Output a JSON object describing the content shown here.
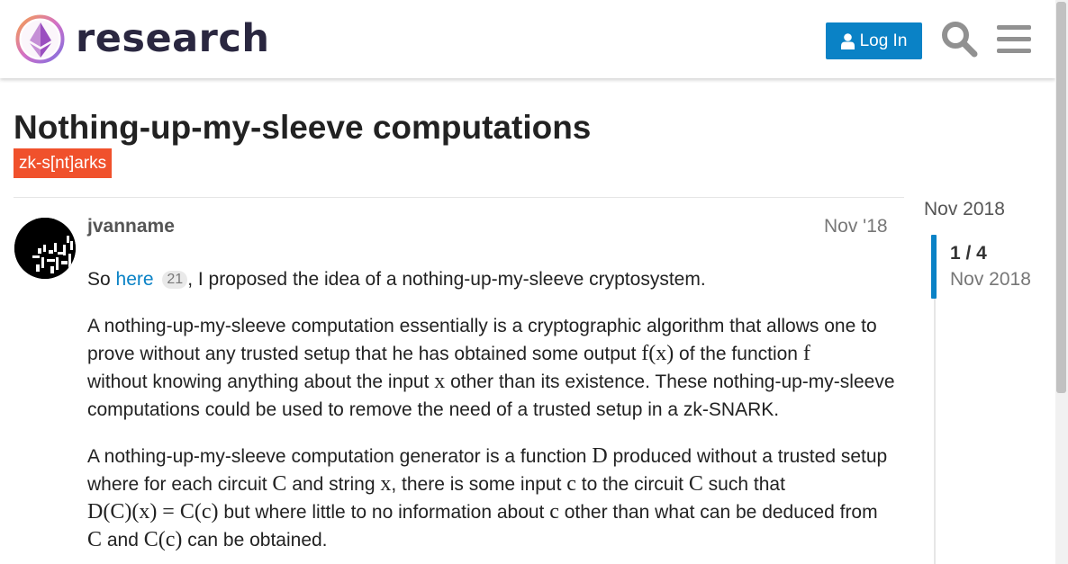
{
  "header": {
    "logo_text": "research",
    "login_label": "Log In"
  },
  "topic": {
    "title": "Nothing-up-my-sleeve computations",
    "tag": "zk-s[nt]arks"
  },
  "post": {
    "username": "jvanname",
    "date": "Nov '18",
    "p1": {
      "before": "So ",
      "link": "here",
      "clicks": "21",
      "after": ", I proposed the idea of a nothing-up-my-sleeve cryptosystem."
    },
    "p2": {
      "t1": "A nothing-up-my-sleeve computation essentially is a cryptographic algorithm that allows one to prove without any trusted setup that he has obtained some output ",
      "m1": "f(x)",
      "t2": " of the function ",
      "m2": "f",
      "t3": " without knowing anything about the input ",
      "m3": "x",
      "t4": " other than its existence. These nothing-up-my-sleeve computations could be used to remove the need of a trusted setup in a zk-SNARK."
    },
    "p3": {
      "t1": "A nothing-up-my-sleeve computation generator is a function ",
      "m1": "D",
      "t2": " produced without a trusted setup where for each circuit ",
      "m2": "C",
      "t3": " and string ",
      "m3": "x",
      "t4": ", there is some input ",
      "m4": "c",
      "t5": " to the circuit ",
      "m5": "C",
      "t6": " such that ",
      "m6": "D(C)(x) = C(c)",
      "t7": " but where little to no information about ",
      "m7": "c",
      "t8": " other than what can be deduced from ",
      "m8": "C",
      "t9": " and ",
      "m9": "C(c)",
      "t10": " can be obtained."
    }
  },
  "timeline": {
    "start_date": "Nov 2018",
    "position": "1 / 4",
    "current_date": "Nov 2018"
  },
  "colors": {
    "accent": "#0a82c6",
    "tag": "#f0512c"
  }
}
